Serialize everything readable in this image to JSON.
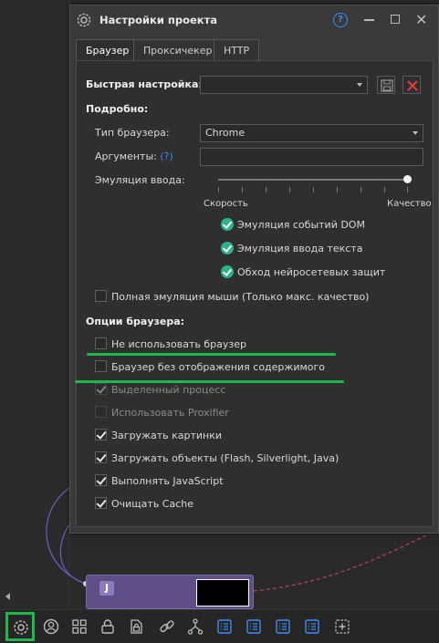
{
  "dialog": {
    "title": "Настройки проекта",
    "help_label": "?"
  },
  "tabs": [
    {
      "label": "Браузер",
      "active": true
    },
    {
      "label": "Проксичекер",
      "active": false
    },
    {
      "label": "HTTP",
      "active": false
    }
  ],
  "quick_setup": {
    "label": "Быстрая настройка:",
    "value": ""
  },
  "details": {
    "heading": "Подробно:",
    "browser_type_label": "Тип браузера:",
    "browser_type_value": "Chrome",
    "arguments_label": "Аргументы:",
    "arguments_help": "(?)",
    "arguments_value": "",
    "input_emulation_label": "Эмуляция ввода:",
    "slider_left": "Скорость",
    "slider_right": "Качество",
    "slider_level": 1.0,
    "features": [
      {
        "label": "Эмуляция событий DOM",
        "enabled": true
      },
      {
        "label": "Эмуляция ввода текста",
        "enabled": true
      },
      {
        "label": "Обход нейросетевых защит",
        "enabled": true
      }
    ],
    "full_mouse": {
      "label": "Полная эмуляция мыши (Только макс. качество)",
      "checked": false
    }
  },
  "browser_options": {
    "heading": "Опции браузера:",
    "items": [
      {
        "label": "Не использовать браузер",
        "checked": false,
        "disabled": false
      },
      {
        "label": "Браузер без отображения содержимого",
        "checked": false,
        "disabled": false
      },
      {
        "label": "Выделенный процесс",
        "checked": true,
        "disabled": true
      },
      {
        "label": "Использовать Proxifier",
        "checked": false,
        "disabled": true
      },
      {
        "label": "Загружать картинки",
        "checked": true,
        "disabled": false
      },
      {
        "label": "Загружать объекты (Flash, Silverlight, Java)",
        "checked": true,
        "disabled": false
      },
      {
        "label": "Выполнять JavaScript",
        "checked": true,
        "disabled": false
      },
      {
        "label": "Очищать Cache",
        "checked": true,
        "disabled": false
      }
    ]
  },
  "colors": {
    "accent": "#3a8df0",
    "check_green": "#2bb38a",
    "highlight_green": "#1fb84a",
    "close_red": "#e0403a"
  },
  "toolbar_icons": [
    "settings-icon",
    "user-icon",
    "grid-icon",
    "lock-icon",
    "lock-doc-icon",
    "link-icon",
    "tree-icon",
    "list-icon",
    "list-icon",
    "list-icon",
    "list-icon",
    "add-icon"
  ]
}
